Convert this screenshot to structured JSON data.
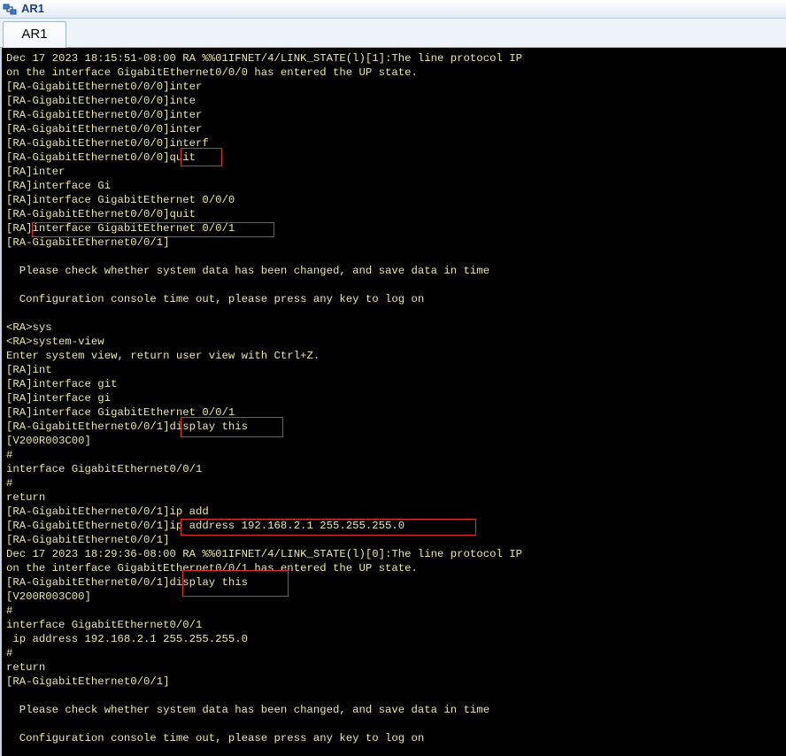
{
  "window": {
    "title": "AR1",
    "icon": "router-icon"
  },
  "tabs": [
    {
      "label": "AR1"
    }
  ],
  "colors": {
    "console_bg": "#000000",
    "console_text": "#ece8a3",
    "highlight": "#e03030"
  },
  "console": {
    "lines": [
      "Dec 17 2023 18:15:51-08:00 RA %%01IFNET/4/LINK_STATE(l)[1]:The line protocol IP",
      "on the interface GigabitEthernet0/0/0 has entered the UP state.",
      "[RA-GigabitEthernet0/0/0]inter",
      "[RA-GigabitEthernet0/0/0]inte",
      "[RA-GigabitEthernet0/0/0]inter",
      "[RA-GigabitEthernet0/0/0]inter",
      "[RA-GigabitEthernet0/0/0]interf",
      "[RA-GigabitEthernet0/0/0]quit",
      "[RA]inter",
      "[RA]interface Gi",
      "[RA]interface GigabitEthernet 0/0/0",
      "[RA-GigabitEthernet0/0/0]quit",
      "[RA]interface GigabitEthernet 0/0/1",
      "[RA-GigabitEthernet0/0/1]",
      "",
      "  Please check whether system data has been changed, and save data in time",
      "",
      "  Configuration console time out, please press any key to log on",
      "",
      "<RA>sys",
      "<RA>system-view",
      "Enter system view, return user view with Ctrl+Z.",
      "[RA]int",
      "[RA]interface git",
      "[RA]interface gi",
      "[RA]interface GigabitEthernet 0/0/1",
      "[RA-GigabitEthernet0/0/1]display this",
      "[V200R003C00]",
      "#",
      "interface GigabitEthernet0/0/1",
      "#",
      "return",
      "[RA-GigabitEthernet0/0/1]ip add",
      "[RA-GigabitEthernet0/0/1]ip address 192.168.2.1 255.255.255.0",
      "[RA-GigabitEthernet0/0/1]",
      "Dec 17 2023 18:29:36-08:00 RA %%01IFNET/4/LINK_STATE(l)[0]:The line protocol IP",
      "on the interface GigabitEthernet0/0/1 has entered the UP state.",
      "[RA-GigabitEthernet0/0/1]display this",
      "[V200R003C00]",
      "#",
      "interface GigabitEthernet0/0/1",
      " ip address 192.168.2.1 255.255.255.0",
      "#",
      "return",
      "[RA-GigabitEthernet0/0/1]",
      "",
      "  Please check whether system data has been changed, and save data in time",
      "",
      "  Configuration console time out, please press any key to log on"
    ]
  }
}
